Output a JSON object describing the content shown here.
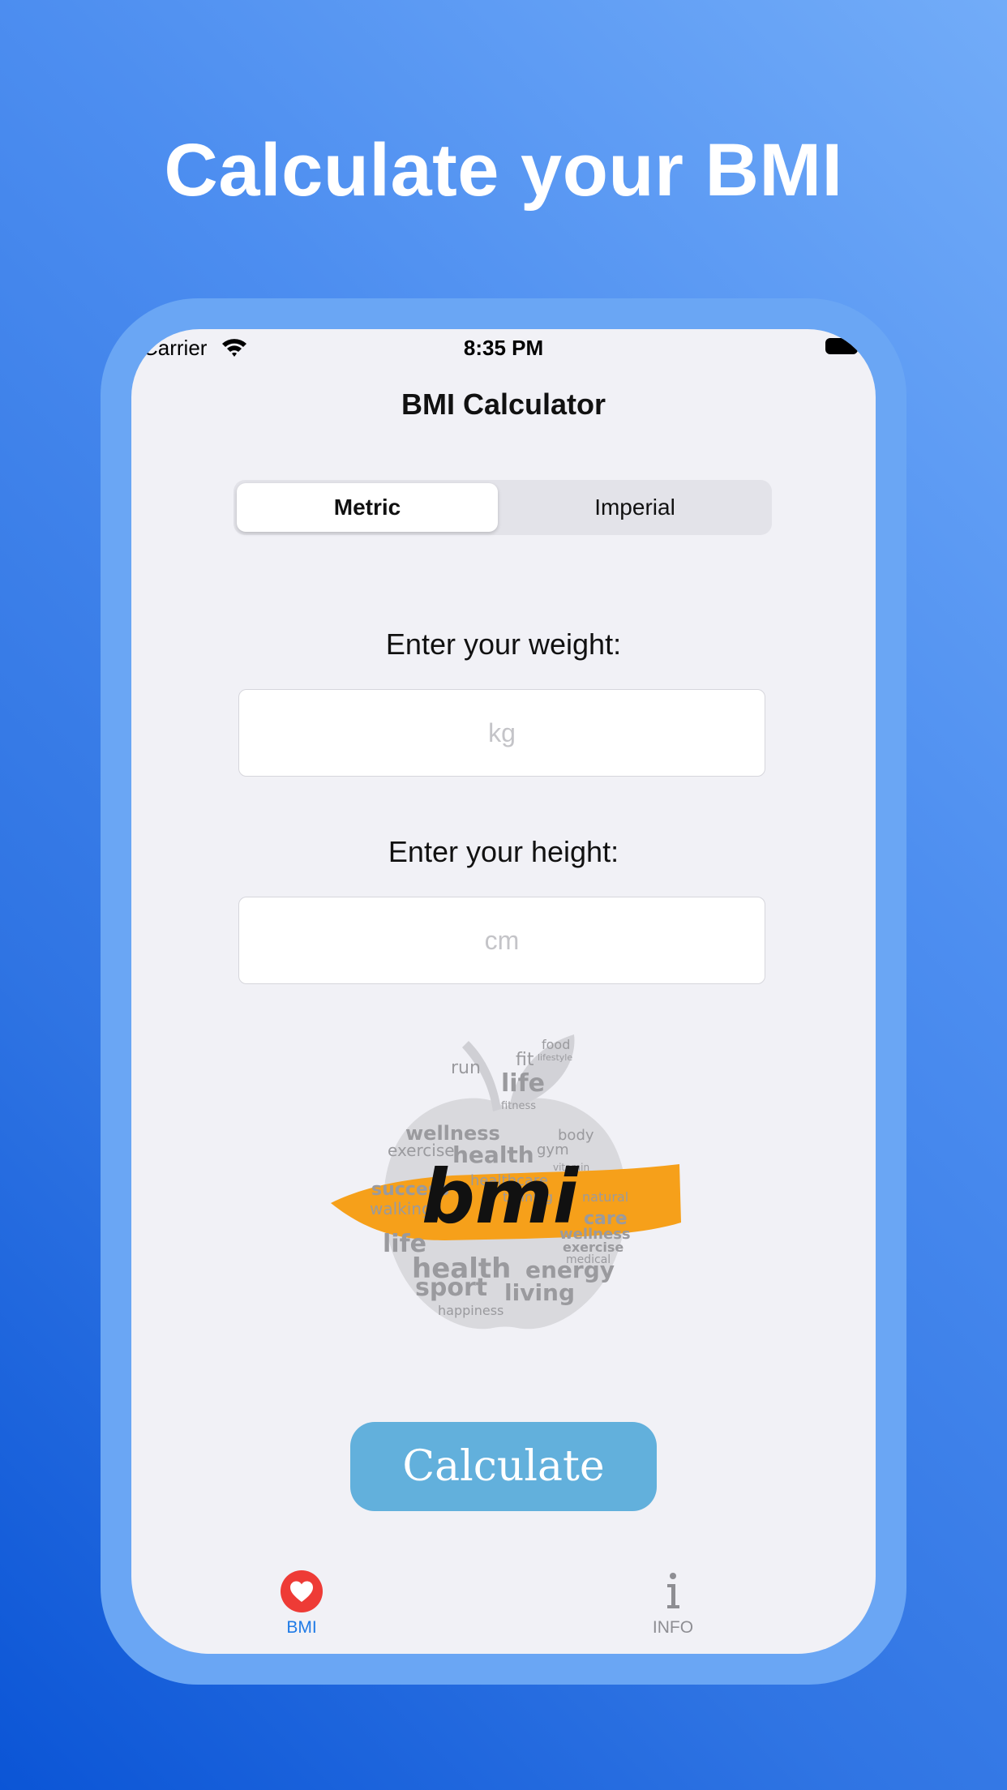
{
  "headline": "Calculate your BMI",
  "status_bar": {
    "carrier": "Carrier",
    "time": "8:35 PM"
  },
  "nav": {
    "title": "BMI Calculator"
  },
  "segmented": {
    "options": [
      "Metric",
      "Imperial"
    ],
    "selected": "Metric"
  },
  "weight": {
    "label": "Enter your weight:",
    "placeholder": "kg",
    "value": ""
  },
  "height": {
    "label": "Enter your height:",
    "placeholder": "cm",
    "value": ""
  },
  "logo": {
    "main_text": "bmi",
    "words": [
      "run",
      "fit",
      "life",
      "fitness",
      "food",
      "lifestyle",
      "wellness",
      "exercise",
      "health",
      "healthcare",
      "success",
      "walking",
      "training",
      "natural",
      "sport",
      "living",
      "care",
      "energy",
      "happiness",
      "body",
      "medical",
      "gym",
      "vitamin"
    ]
  },
  "calculate_button": {
    "label": "Calculate"
  },
  "tabs": [
    {
      "label": "BMI",
      "icon": "heart-icon",
      "active": true
    },
    {
      "label": "INFO",
      "icon": "info-icon",
      "active": false
    }
  ],
  "colors": {
    "accent": "#1f7ae6",
    "button": "#62b0dc",
    "heart": "#ee3b36",
    "logo_stroke": "#f6a01a"
  }
}
